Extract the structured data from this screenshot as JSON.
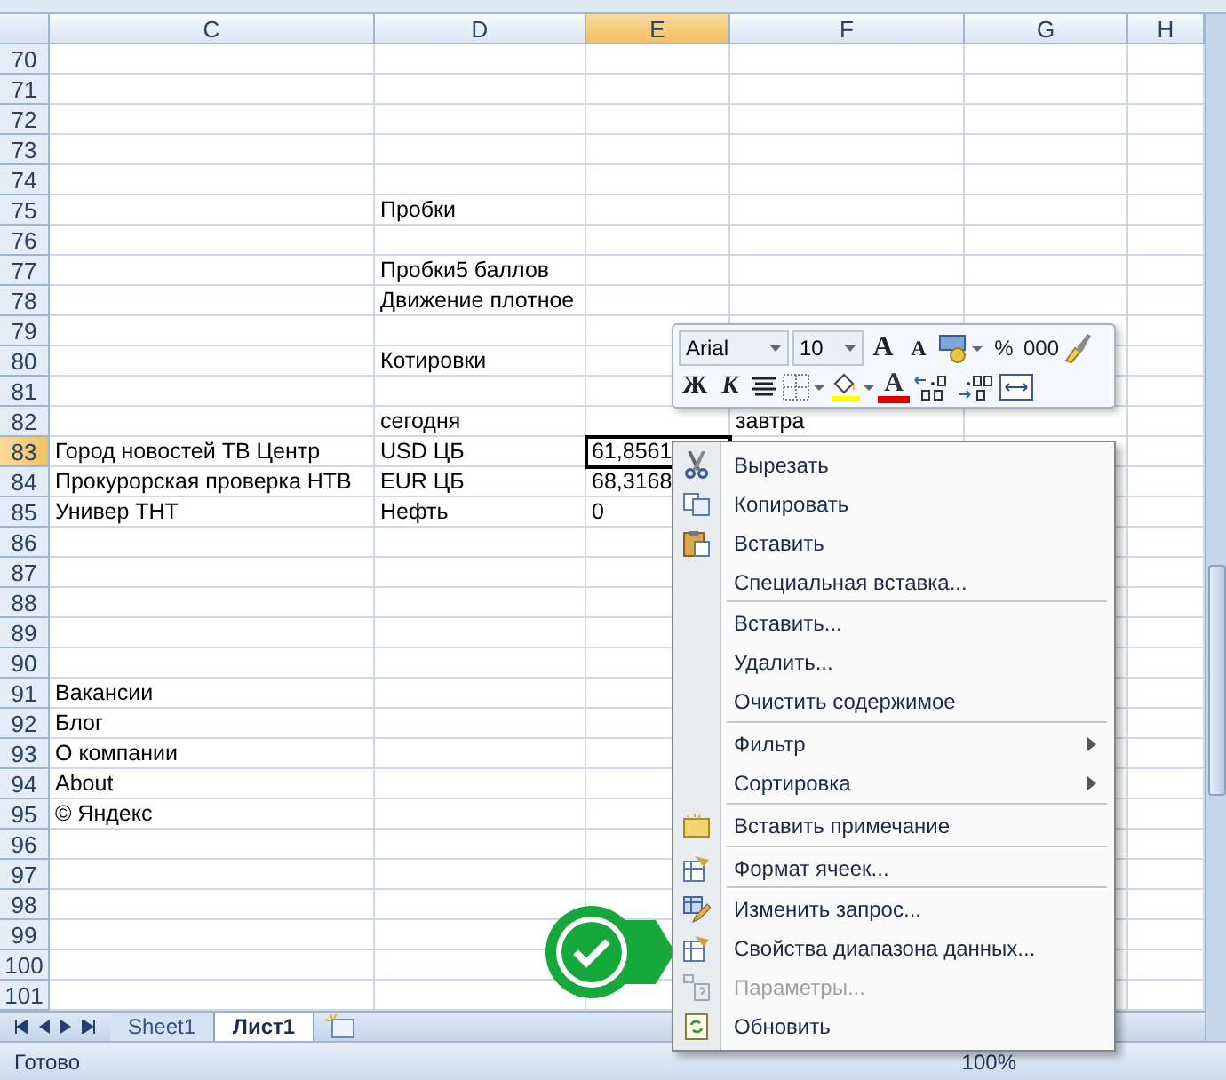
{
  "columns": [
    {
      "label": "C",
      "selected": false
    },
    {
      "label": "D",
      "selected": false
    },
    {
      "label": "E",
      "selected": true
    },
    {
      "label": "F",
      "selected": false
    },
    {
      "label": "G",
      "selected": false
    },
    {
      "label": "H",
      "selected": false
    }
  ],
  "rows": [
    {
      "number": "70",
      "selected": false,
      "cells": {}
    },
    {
      "number": "71",
      "selected": false,
      "cells": {}
    },
    {
      "number": "72",
      "selected": false,
      "cells": {}
    },
    {
      "number": "73",
      "selected": false,
      "cells": {}
    },
    {
      "number": "74",
      "selected": false,
      "cells": {}
    },
    {
      "number": "75",
      "selected": false,
      "cells": {
        "D": "Пробки"
      }
    },
    {
      "number": "76",
      "selected": false,
      "cells": {}
    },
    {
      "number": "77",
      "selected": false,
      "cells": {
        "D": "Пробки5 баллов"
      }
    },
    {
      "number": "78",
      "selected": false,
      "cells": {
        "D": "Движение плотное"
      }
    },
    {
      "number": "79",
      "selected": false,
      "cells": {}
    },
    {
      "number": "80",
      "selected": false,
      "cells": {
        "D": "Котировки"
      }
    },
    {
      "number": "81",
      "selected": false,
      "cells": {}
    },
    {
      "number": "82",
      "selected": false,
      "cells": {
        "D": "сегодня",
        "F": "завтра"
      }
    },
    {
      "number": "83",
      "selected": true,
      "cells": {
        "C": "Город новостей ТВ Центр",
        "D": "USD ЦБ",
        "E": "61,8561"
      }
    },
    {
      "number": "84",
      "selected": false,
      "cells": {
        "C": "Прокурорская проверка НТВ",
        "D": "EUR ЦБ",
        "E": "68,3168"
      }
    },
    {
      "number": "85",
      "selected": false,
      "cells": {
        "C": "Универ ТНТ",
        "D": "Нефть",
        "E": "0"
      }
    },
    {
      "number": "86",
      "selected": false,
      "cells": {}
    },
    {
      "number": "87",
      "selected": false,
      "cells": {}
    },
    {
      "number": "88",
      "selected": false,
      "cells": {}
    },
    {
      "number": "89",
      "selected": false,
      "cells": {}
    },
    {
      "number": "90",
      "selected": false,
      "cells": {}
    },
    {
      "number": "91",
      "selected": false,
      "cells": {
        "C": "Вакансии"
      }
    },
    {
      "number": "92",
      "selected": false,
      "cells": {
        "C": "Блог"
      }
    },
    {
      "number": "93",
      "selected": false,
      "cells": {
        "C": "О компании"
      }
    },
    {
      "number": "94",
      "selected": false,
      "cells": {
        "C": "About"
      }
    },
    {
      "number": "95",
      "selected": false,
      "cells": {
        "C": "© Яндекс"
      }
    },
    {
      "number": "96",
      "selected": false,
      "cells": {}
    },
    {
      "number": "97",
      "selected": false,
      "cells": {}
    },
    {
      "number": "98",
      "selected": false,
      "cells": {}
    },
    {
      "number": "99",
      "selected": false,
      "cells": {}
    },
    {
      "number": "100",
      "selected": false,
      "cells": {}
    },
    {
      "number": "101",
      "selected": false,
      "cells": {}
    }
  ],
  "sheet_tabs": [
    {
      "label": "Sheet1",
      "selected": false
    },
    {
      "label": "Лист1",
      "selected": true
    }
  ],
  "status_bar": {
    "text": "Готово",
    "zoom": "100%"
  },
  "mini_toolbar": {
    "font": "Arial",
    "size": "10",
    "rows": [
      [
        {
          "kind": "grow",
          "label": "A"
        },
        {
          "kind": "shrink",
          "label": "A"
        },
        {
          "kind": "currency"
        },
        {
          "kind": "text",
          "label": "%"
        },
        {
          "kind": "text",
          "label": "000"
        },
        {
          "kind": "painter"
        }
      ],
      [
        {
          "kind": "bold",
          "label": "Ж"
        },
        {
          "kind": "italic",
          "label": "К"
        },
        {
          "kind": "center"
        },
        {
          "kind": "borders"
        },
        {
          "kind": "fill"
        },
        {
          "kind": "fontcolor",
          "label": "A"
        },
        {
          "kind": "incdec"
        },
        {
          "kind": "decdec"
        },
        {
          "kind": "merge"
        }
      ]
    ]
  },
  "context_menu": [
    {
      "kind": "cut",
      "label": "Вырезать",
      "disabled": false,
      "submenu": false
    },
    {
      "kind": "copy",
      "label": "Копировать",
      "disabled": false,
      "submenu": false
    },
    {
      "kind": "paste",
      "label": "Вставить",
      "disabled": false,
      "submenu": false
    },
    {
      "kind": "plain",
      "label": "Специальная вставка...",
      "disabled": false,
      "submenu": false
    },
    {
      "kind": "separator"
    },
    {
      "kind": "plain",
      "label": "Вставить...",
      "disabled": false,
      "submenu": false
    },
    {
      "kind": "plain",
      "label": "Удалить...",
      "disabled": false,
      "submenu": false
    },
    {
      "kind": "plain",
      "label": "Очистить содержимое",
      "disabled": false,
      "submenu": false
    },
    {
      "kind": "separator"
    },
    {
      "kind": "plain",
      "label": "Фильтр",
      "disabled": false,
      "submenu": true
    },
    {
      "kind": "plain",
      "label": "Сортировка",
      "disabled": false,
      "submenu": true
    },
    {
      "kind": "separator"
    },
    {
      "kind": "note",
      "label": "Вставить примечание",
      "disabled": false,
      "submenu": false
    },
    {
      "kind": "separator"
    },
    {
      "kind": "format",
      "label": "Формат ячеек...",
      "disabled": false,
      "submenu": false
    },
    {
      "kind": "separator"
    },
    {
      "kind": "query",
      "label": "Изменить запрос...",
      "disabled": false,
      "submenu": false
    },
    {
      "kind": "format",
      "label": "Свойства диапазона данных...",
      "disabled": false,
      "submenu": false
    },
    {
      "kind": "params",
      "label": "Параметры...",
      "disabled": true,
      "submenu": false
    },
    {
      "kind": "refresh",
      "label": "Обновить",
      "disabled": false,
      "submenu": false
    }
  ]
}
